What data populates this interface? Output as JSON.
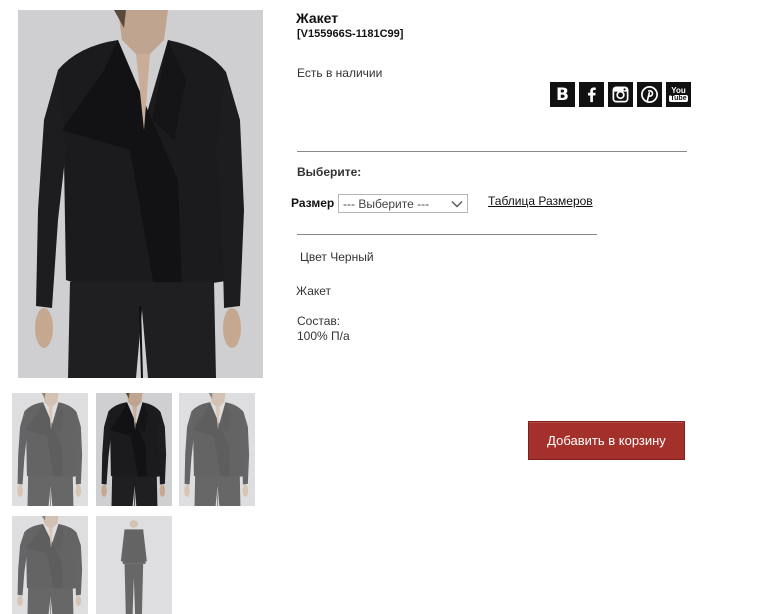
{
  "product": {
    "title": "Жакет",
    "sku": "[V155966S-1181C99]",
    "availability": "Есть в наличии",
    "choose_label": "Выберите:",
    "size": {
      "label": "Размер",
      "selected": "--- Выберите ---",
      "chart_link": "Таблица Размеров"
    },
    "color_line": "Цвет Черный",
    "description": "Жакет",
    "composition_label": "Состав:",
    "composition_value": "100% П/а",
    "add_to_cart": "Добавить в корзину"
  },
  "social": {
    "vk": "В",
    "youtube_top": "You",
    "youtube_bottom": "Tube",
    "icons": [
      "vk-icon",
      "facebook-icon",
      "instagram-icon",
      "pinterest-icon",
      "youtube-icon"
    ]
  },
  "gallery": {
    "thumbnails": [
      "jacket-front-thumb",
      "jacket-front-dark-thumb",
      "jacket-side-thumb",
      "jacket-back-thumb",
      "full-look-thumb"
    ]
  },
  "colors": {
    "button": "#a4302b",
    "garment": "#1b1b1d",
    "photo_background": "#cfcfd1"
  }
}
